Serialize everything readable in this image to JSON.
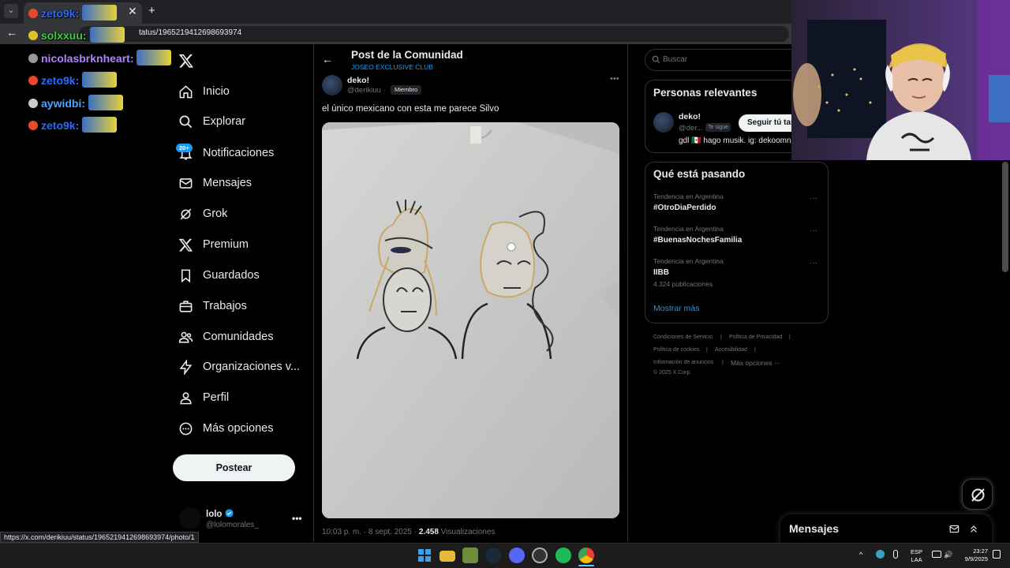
{
  "browser": {
    "tab_chevron": "⌄",
    "tab_close": "✕",
    "tab_new": "+",
    "url": "tatus/1965219412698693974",
    "status_url": "https://x.com/derikiuu/status/1965219412698693974/photo/1"
  },
  "chat": [
    {
      "user": "zeto9k:",
      "color": "#2a6bff",
      "badge": "#e8492e"
    },
    {
      "user": "solxxuu:",
      "color": "#3ad13a",
      "badge": "#e0c12b"
    },
    {
      "user": "nicolasbrknheart:",
      "color": "#b085f5",
      "badge": "#9a9a9a"
    },
    {
      "user": "zeto9k:",
      "color": "#2a6bff",
      "badge": "#e8492e"
    },
    {
      "user": "aywidbi:",
      "color": "#4da3ff",
      "badge": "#cccccc"
    },
    {
      "user": "zeto9k:",
      "color": "#2a6bff",
      "badge": "#e8492e"
    }
  ],
  "nav": {
    "items": [
      {
        "label": "Inicio",
        "icon": "home-icon"
      },
      {
        "label": "Explorar",
        "icon": "search-icon"
      },
      {
        "label": "Notificaciones",
        "icon": "bell-icon"
      },
      {
        "label": "Mensajes",
        "icon": "envelope-icon"
      },
      {
        "label": "Grok",
        "icon": "grok-icon"
      },
      {
        "label": "Premium",
        "icon": "x-logo-icon"
      },
      {
        "label": "Guardados",
        "icon": "bookmark-icon"
      },
      {
        "label": "Trabajos",
        "icon": "briefcase-icon"
      },
      {
        "label": "Comunidades",
        "icon": "people-icon"
      },
      {
        "label": "Organizaciones v...",
        "icon": "lightning-icon"
      },
      {
        "label": "Perfil",
        "icon": "person-icon"
      },
      {
        "label": "Más opciones",
        "icon": "more-circle-icon"
      }
    ],
    "notif_badge": "20+",
    "post_button": "Postear",
    "account": {
      "name": "lolo",
      "handle": "@lolomorales_",
      "more": "•••"
    }
  },
  "post": {
    "back": "←",
    "title": "Post de la Comunidad",
    "community": "JOSEO EXCLUSIVE CLUB",
    "author_name": "deko!",
    "author_handle": "@derikiuu ·",
    "member_badge": "Miembro",
    "more": "•••",
    "text": "el único mexicano con esta me parece Silvo",
    "time": "10:03 p. m. · 8 sept. 2025 ·",
    "views_count": "2.458",
    "views_label": "Visualizaciones"
  },
  "sidebar": {
    "search_placeholder": "Buscar",
    "people_title": "Personas relevantes",
    "person": {
      "name": "deko!",
      "handle": "@der...",
      "follows_you": "Te sigue",
      "follow_button": "Seguir tú tan",
      "bio": "gdl 🇲🇽 hago musik. ig: dekoomn"
    },
    "trends_title": "Qué está pasando",
    "trends": [
      {
        "context": "Tendencia en Argentina",
        "name": "#OtroDiaPerdido",
        "count": ""
      },
      {
        "context": "Tendencia en Argentina",
        "name": "#BuenasNochesFamilia",
        "count": ""
      },
      {
        "context": "Tendencia en Argentina",
        "name": "IIBB",
        "count": "4.324 publicaciones"
      }
    ],
    "trend_more": "···",
    "show_more": "Mostrar más",
    "footer": {
      "terms": "Condiciones de Servicio",
      "privacy": "Política de Privacidad",
      "cookies": "Política de cookies",
      "accessibility": "Accesibilidad",
      "ads": "Información de anuncios",
      "more": "Más opciones ···",
      "copyright": "© 2025 X Corp.",
      "separator": "|"
    }
  },
  "messages": {
    "title": "Mensajes"
  },
  "taskbar": {
    "lang_line1": "ESP",
    "lang_line2": "LAA",
    "time": "23:27",
    "date": "9/9/2025",
    "tray_chevron": "^",
    "tray_speaker": "🔊"
  },
  "colors": {
    "accent": "#1d9bf0",
    "background": "#000000",
    "text": "#e7e9ea",
    "muted": "#71767b"
  }
}
